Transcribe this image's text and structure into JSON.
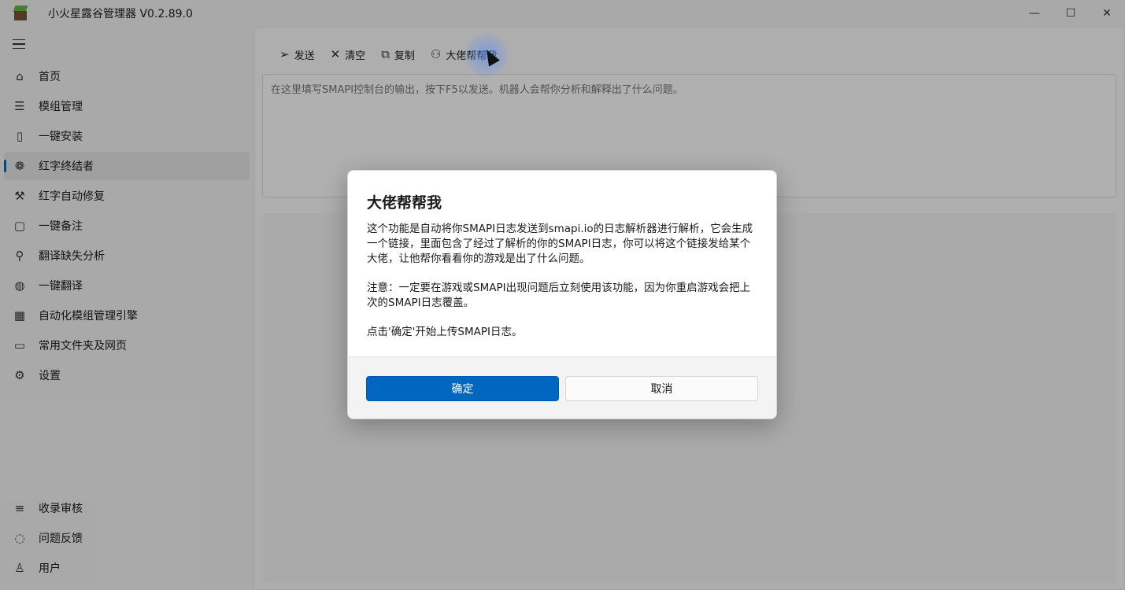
{
  "window": {
    "title": "小火星露谷管理器 V0.2.89.0",
    "controls": {
      "minimize": "—",
      "maximize": "☐",
      "close": "✕"
    }
  },
  "nav": {
    "items": [
      {
        "label": "首页",
        "icon": "home-icon",
        "glyph": "⌂"
      },
      {
        "label": "模组管理",
        "icon": "list-icon",
        "glyph": "☰"
      },
      {
        "label": "一键安装",
        "icon": "package-icon",
        "glyph": "▯"
      },
      {
        "label": "红字终结者",
        "icon": "bug-icon",
        "glyph": "❁"
      },
      {
        "label": "红字自动修复",
        "icon": "wrench-icon",
        "glyph": "⚒"
      },
      {
        "label": "一键备注",
        "icon": "note-icon",
        "glyph": "▢"
      },
      {
        "label": "翻译缺失分析",
        "icon": "search-icon",
        "glyph": "⚲"
      },
      {
        "label": "一键翻译",
        "icon": "globe-icon",
        "glyph": "◍"
      },
      {
        "label": "自动化模组管理引擎",
        "icon": "calculator-icon",
        "glyph": "▦"
      },
      {
        "label": "常用文件夹及网页",
        "icon": "folder-icon",
        "glyph": "▭"
      },
      {
        "label": "设置",
        "icon": "gear-icon",
        "glyph": "⚙"
      }
    ],
    "bottom_items": [
      {
        "label": "收录审核",
        "icon": "review-icon",
        "glyph": "≡"
      },
      {
        "label": "问题反馈",
        "icon": "feedback-icon",
        "glyph": "◌"
      },
      {
        "label": "用户",
        "icon": "user-icon",
        "glyph": "♙"
      }
    ]
  },
  "toolbar": {
    "send": {
      "label": "发送",
      "glyph": "➢"
    },
    "clear": {
      "label": "清空",
      "glyph": "✕"
    },
    "copy": {
      "label": "复制",
      "glyph": "⧉"
    },
    "help": {
      "label": "大佬帮帮我",
      "glyph": "⚇"
    }
  },
  "log_input": {
    "placeholder": "在这里填写SMAPI控制台的输出，按下F5以发送。机器人会帮你分析和解释出了什么问题。"
  },
  "dialog": {
    "title": "大佬帮帮我",
    "paragraph1": "这个功能是自动将你SMAPI日志发送到smapi.io的日志解析器进行解析，它会生成一个链接，里面包含了经过了解析的你的SMAPI日志，你可以将这个链接发给某个大佬，让他帮你看看你的游戏是出了什么问题。",
    "paragraph2": "注意：一定要在游戏或SMAPI出现问题后立刻使用该功能，因为你重启游戏会把上次的SMAPI日志覆盖。",
    "paragraph3": "点击'确定'开始上传SMAPI日志。",
    "confirm_label": "确定",
    "cancel_label": "取消"
  },
  "colors": {
    "accent": "#0067c0",
    "active_indicator": "#0067c0"
  }
}
